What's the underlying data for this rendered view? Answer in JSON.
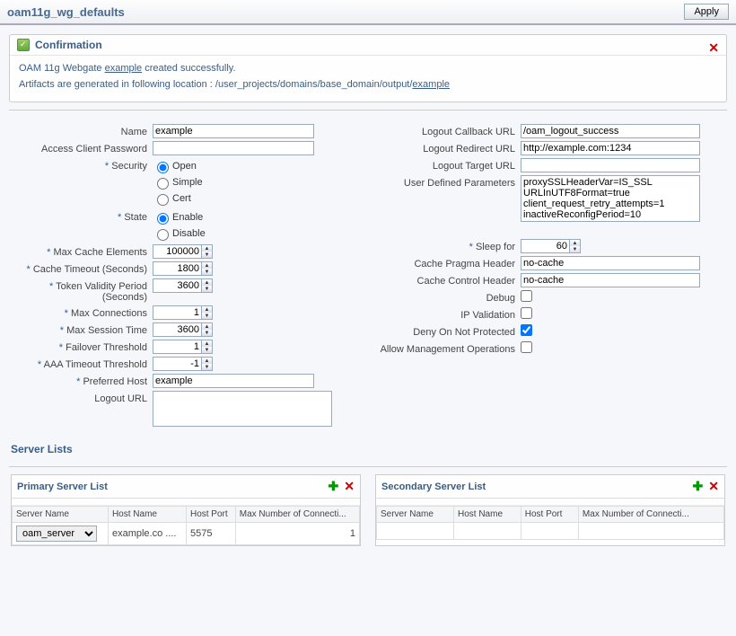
{
  "header": {
    "title": "oam11g_wg_defaults",
    "apply": "Apply"
  },
  "confirmation": {
    "title": "Confirmation",
    "line1_pre": "OAM 11g Webgate ",
    "line1_link": "example",
    "line1_post": " created successfully.",
    "line2_pre": "Artifacts are generated in following location : /user_projects/domains/base_domain/output/",
    "line2_link": "example"
  },
  "left": {
    "name_label": "Name",
    "name_value": "example",
    "acp_label": "Access Client Password",
    "acp_value": "",
    "security_label": "Security",
    "security_options": [
      "Open",
      "Simple",
      "Cert"
    ],
    "state_label": "State",
    "state_options": [
      "Enable",
      "Disable"
    ],
    "max_cache_label": "Max Cache Elements",
    "max_cache": "100000",
    "cache_timeout_label": "Cache Timeout (Seconds)",
    "cache_timeout": "1800",
    "token_validity_label": "Token Validity Period (Seconds)",
    "token_validity": "3600",
    "max_conn_label": "Max Connections",
    "max_conn": "1",
    "max_session_label": "Max Session Time",
    "max_session": "3600",
    "failover_label": "Failover Threshold",
    "failover": "1",
    "aaa_label": "AAA Timeout Threshold",
    "aaa": "-1",
    "pref_host_label": "Preferred Host",
    "pref_host": "example",
    "logout_url_label": "Logout URL",
    "logout_url": ""
  },
  "right": {
    "logout_cb_label": "Logout Callback URL",
    "logout_cb": "/oam_logout_success",
    "logout_rd_label": "Logout Redirect URL",
    "logout_rd": "http://example.com:1234",
    "logout_tg_label": "Logout Target URL",
    "logout_tg": "",
    "udp_label": "User Defined Parameters",
    "udp_value": "proxySSLHeaderVar=IS_SSL\nURLInUTF8Format=true\nclient_request_retry_attempts=1\ninactiveReconfigPeriod=10",
    "sleep_label": "Sleep for",
    "sleep": "60",
    "cache_pragma_label": "Cache Pragma Header",
    "cache_pragma": "no-cache",
    "cache_ctrl_label": "Cache Control Header",
    "cache_ctrl": "no-cache",
    "debug_label": "Debug",
    "ipval_label": "IP Validation",
    "deny_label": "Deny On Not Protected",
    "allow_mgmt_label": "Allow Management Operations"
  },
  "server_lists_title": "Server Lists",
  "primary": {
    "title": "Primary Server List",
    "cols": [
      "Server Name",
      "Host Name",
      "Host Port",
      "Max Number of Connecti..."
    ],
    "row": {
      "server": "oam_server",
      "host": "example.co  ....",
      "port": "5575",
      "max": "1"
    }
  },
  "secondary": {
    "title": "Secondary Server List",
    "cols": [
      "Server Name",
      "Host Name",
      "Host Port",
      "Max Number of Connecti..."
    ]
  }
}
